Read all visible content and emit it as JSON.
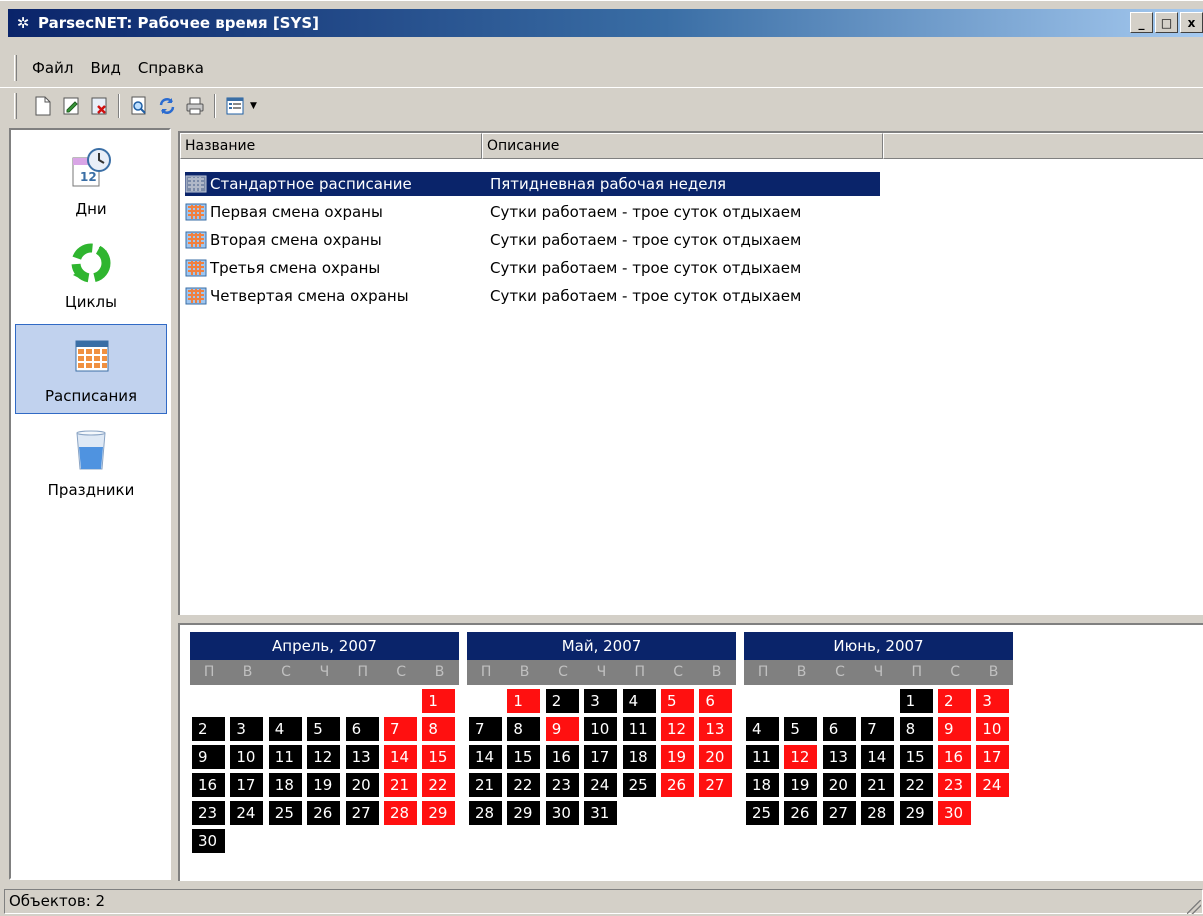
{
  "window": {
    "title": "ParsecNET: Рабочее время [SYS]",
    "minimize_label": "_",
    "maximize_label": "□",
    "close_label": "x"
  },
  "menu": {
    "items": [
      "Файл",
      "Вид",
      "Справка"
    ]
  },
  "toolbar": {
    "buttons": [
      "new-document-icon",
      "edit-document-icon",
      "delete-document-icon",
      "preview-icon",
      "refresh-icon",
      "print-icon",
      "view-options-icon"
    ]
  },
  "nav": {
    "items": [
      {
        "label": "Дни",
        "icon": "days-calendar-clock-icon"
      },
      {
        "label": "Циклы",
        "icon": "cycles-recycle-icon"
      },
      {
        "label": "Расписания",
        "icon": "schedules-grid-icon",
        "selected": true
      },
      {
        "label": "Праздники",
        "icon": "holidays-glass-icon"
      }
    ]
  },
  "list": {
    "columns": [
      "Название",
      "Описание"
    ],
    "rows": [
      {
        "name": "Стандартное расписание",
        "description": "Пятидневная рабочая неделя",
        "selected": true
      },
      {
        "name": "Первая смена охраны",
        "description": "Сутки работаем - трое суток отдыхаем"
      },
      {
        "name": "Вторая смена охраны",
        "description": "Сутки работаем - трое суток отдыхаем"
      },
      {
        "name": "Третья смена охраны",
        "description": "Сутки работаем - трое суток отдыхаем"
      },
      {
        "name": "Четвертая смена охраны",
        "description": "Сутки работаем - трое суток отдыхаем"
      }
    ]
  },
  "calendar": {
    "weekdays": [
      "П",
      "В",
      "С",
      "Ч",
      "П",
      "С",
      "В"
    ],
    "colors": {
      "workday": "#000000",
      "holiday": "#ff1010",
      "header": "#0a246a"
    },
    "months": [
      {
        "title": "Апрель, 2007",
        "first_weekday": 6,
        "days": 30,
        "holidays": [
          1,
          7,
          8,
          14,
          15,
          21,
          22,
          28,
          29
        ]
      },
      {
        "title": "Май, 2007",
        "first_weekday": 1,
        "days": 31,
        "holidays": [
          1,
          5,
          6,
          9,
          12,
          13,
          19,
          20,
          26,
          27
        ]
      },
      {
        "title": "Июнь, 2007",
        "first_weekday": 4,
        "days": 30,
        "holidays": [
          2,
          3,
          9,
          10,
          12,
          16,
          17,
          23,
          24,
          30
        ]
      }
    ]
  },
  "status": {
    "text": "Объектов: 2"
  }
}
